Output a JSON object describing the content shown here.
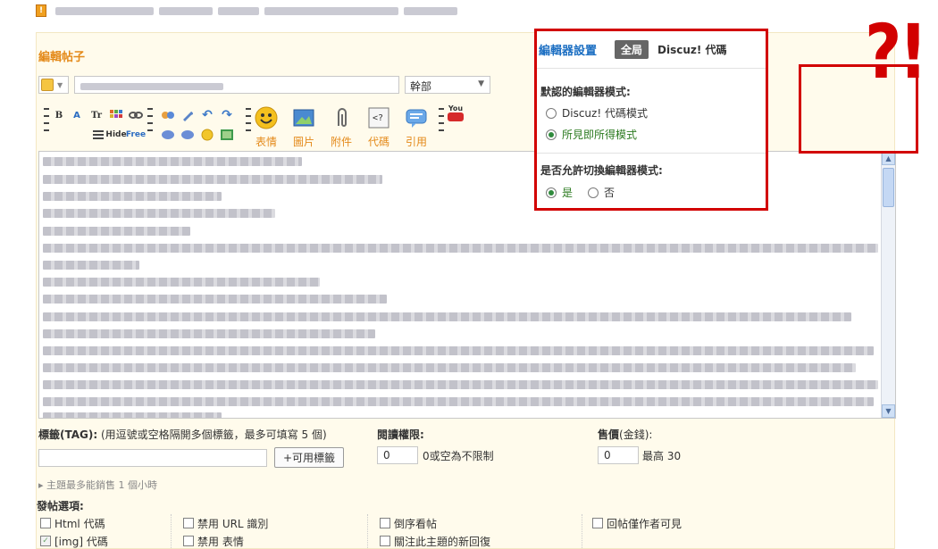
{
  "breadcrumb": {
    "home_icon": "home-icon"
  },
  "post": {
    "title": "編輯帖子",
    "category_value": "幹部",
    "subject_placeholder": ""
  },
  "toolbar": {
    "small_buttons": [
      "B",
      "A",
      "Tr",
      "Hide",
      "Free"
    ],
    "big_buttons": [
      {
        "label": "表情",
        "icon": "smiley-icon"
      },
      {
        "label": "圖片",
        "icon": "image-icon"
      },
      {
        "label": "附件",
        "icon": "paperclip-icon"
      },
      {
        "label": "代碼",
        "icon": "code-icon"
      },
      {
        "label": "引用",
        "icon": "quote-icon"
      }
    ],
    "youtube_label": "You"
  },
  "editor_settings": {
    "title": "編輯器設置",
    "tab_global": "全局",
    "tab_code": "Discuz! 代碼",
    "default_mode_title": "默認的編輯器模式:",
    "mode_options": [
      {
        "label": "Discuz! 代碼模式",
        "selected": false
      },
      {
        "label": "所見即所得模式",
        "selected": true
      }
    ],
    "allow_switch_title": "是否允許切換編輯器模式:",
    "switch_options": [
      {
        "label": "是",
        "selected": true
      },
      {
        "label": "否",
        "selected": false
      }
    ]
  },
  "tags": {
    "label_bold": "標籤(TAG):",
    "label_hint": "(用逗號或空格隔開多個標籤，最多可填寫 5 個)",
    "button": "+可用標籤"
  },
  "read_perm": {
    "label": "閱讀權限:",
    "value": "0",
    "note": "0或空為不限制"
  },
  "price": {
    "label_bold": "售價",
    "label_unit": "(金錢):",
    "value": "0",
    "note": "最高 30"
  },
  "lifetime_note": "▸ 主題最多能銷售 1 個小時",
  "options": {
    "title": "發帖選項:",
    "columns": [
      [
        "Html 代碼",
        "[img] 代碼"
      ],
      [
        "禁用 URL 識別",
        "禁用 表情"
      ],
      [
        "倒序看帖",
        "關注此主題的新回復"
      ],
      [
        "回帖僅作者可見"
      ]
    ]
  },
  "colors": {
    "accent_orange": "#e48a1a",
    "link_blue": "#1b6ec2",
    "annotation_red": "#d20000",
    "panel_bg": "#fffbec"
  },
  "annotation": {
    "mark": "?!"
  }
}
